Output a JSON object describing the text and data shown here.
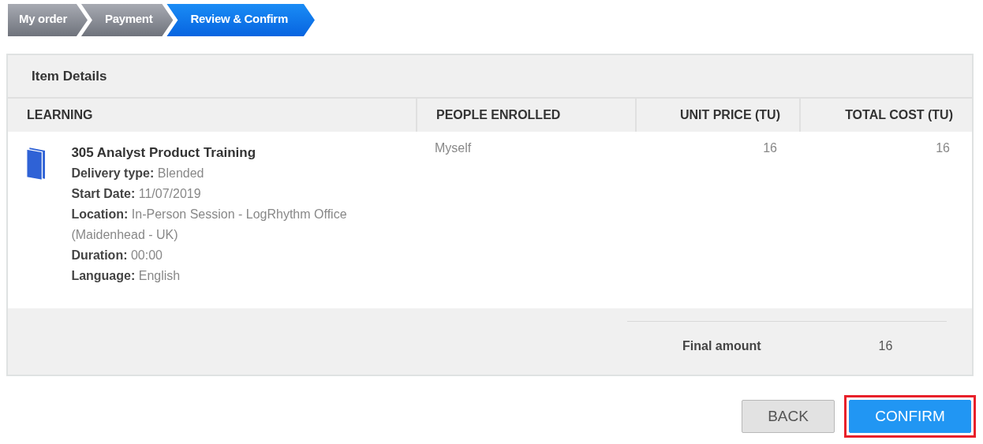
{
  "steps": [
    {
      "label": "My order",
      "selected": false
    },
    {
      "label": "Payment",
      "selected": false
    },
    {
      "label": "Review & Confirm",
      "selected": true
    }
  ],
  "panel": {
    "title": "Item Details",
    "columns": [
      "LEARNING",
      "PEOPLE ENROLLED",
      "UNIT PRICE (TU)",
      "TOTAL COST (TU)"
    ],
    "rows": [
      {
        "title": "305 Analyst Product Training",
        "details": [
          {
            "label": "Delivery type:",
            "value": "Blended"
          },
          {
            "label": "Start Date:",
            "value": "11/07/2019"
          },
          {
            "label": "Location:",
            "value": "In-Person Session - LogRhythm Office (Maidenhead - UK)"
          },
          {
            "label": "Duration:",
            "value": "00:00"
          },
          {
            "label": "Language:",
            "value": "English"
          }
        ],
        "people": "Myself",
        "unit_price": "16",
        "total_cost": "16"
      }
    ],
    "final_label": "Final amount",
    "final_value": "16"
  },
  "buttons": [
    {
      "label": "BACK",
      "kind": "secondary",
      "highlighted": false
    },
    {
      "label": "CONFIRM",
      "kind": "primary",
      "highlighted": true
    }
  ]
}
